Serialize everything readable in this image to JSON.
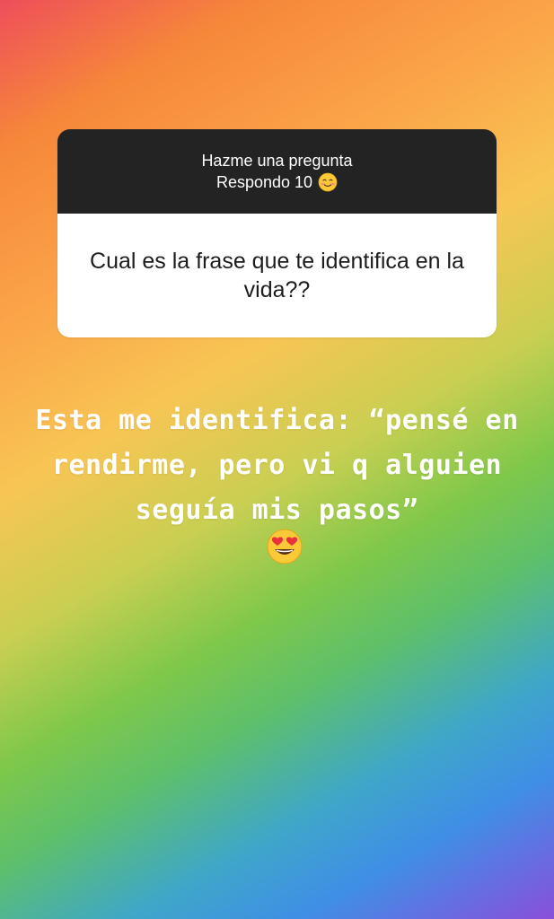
{
  "question_sticker": {
    "header_line1": "Hazme una pregunta",
    "header_line2": "Respondo 10",
    "header_emoji": "smiling-blushing-emoji",
    "question": "Cual es la frase que te identifica en la vida??"
  },
  "answer": {
    "text": "Esta me identifica: “pensé en rendirme, pero vi q alguien seguía mis pasos”",
    "emoji": "heart-eyes-emoji"
  },
  "colors": {
    "sticker_header_bg": "#232323",
    "sticker_body_bg": "#ffffff",
    "answer_text": "#ffffff",
    "gradient": [
      "#ee4e5a",
      "#f6873a",
      "#f8c554",
      "#7fc84a",
      "#3fa7c8",
      "#8a4fd8"
    ]
  }
}
